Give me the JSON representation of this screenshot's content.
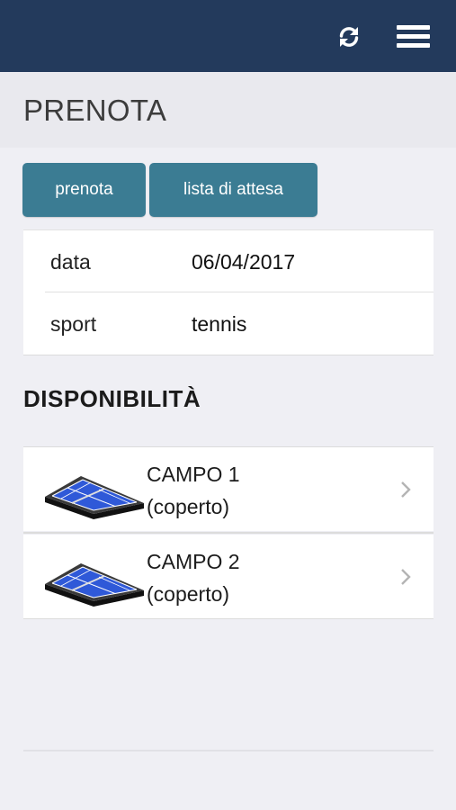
{
  "header": {
    "refresh_icon": "refresh-icon",
    "menu_icon": "hamburger-menu-icon",
    "bg_color": "#233a5c"
  },
  "page": {
    "title": "PRENOTA"
  },
  "tabs": [
    {
      "label": "prenota"
    },
    {
      "label": "lista di attesa"
    }
  ],
  "details": [
    {
      "label": "data",
      "value": "06/04/2017"
    },
    {
      "label": "sport",
      "value": "tennis"
    }
  ],
  "availability": {
    "title": "DISPONIBILITÀ",
    "courts": [
      {
        "name": "CAMPO 1",
        "detail": "(coperto)",
        "icon": "tennis-court-icon"
      },
      {
        "name": "CAMPO 2",
        "detail": "(coperto)",
        "icon": "tennis-court-icon"
      }
    ]
  },
  "colors": {
    "accent": "#3b7c93",
    "background": "#efeff4"
  }
}
